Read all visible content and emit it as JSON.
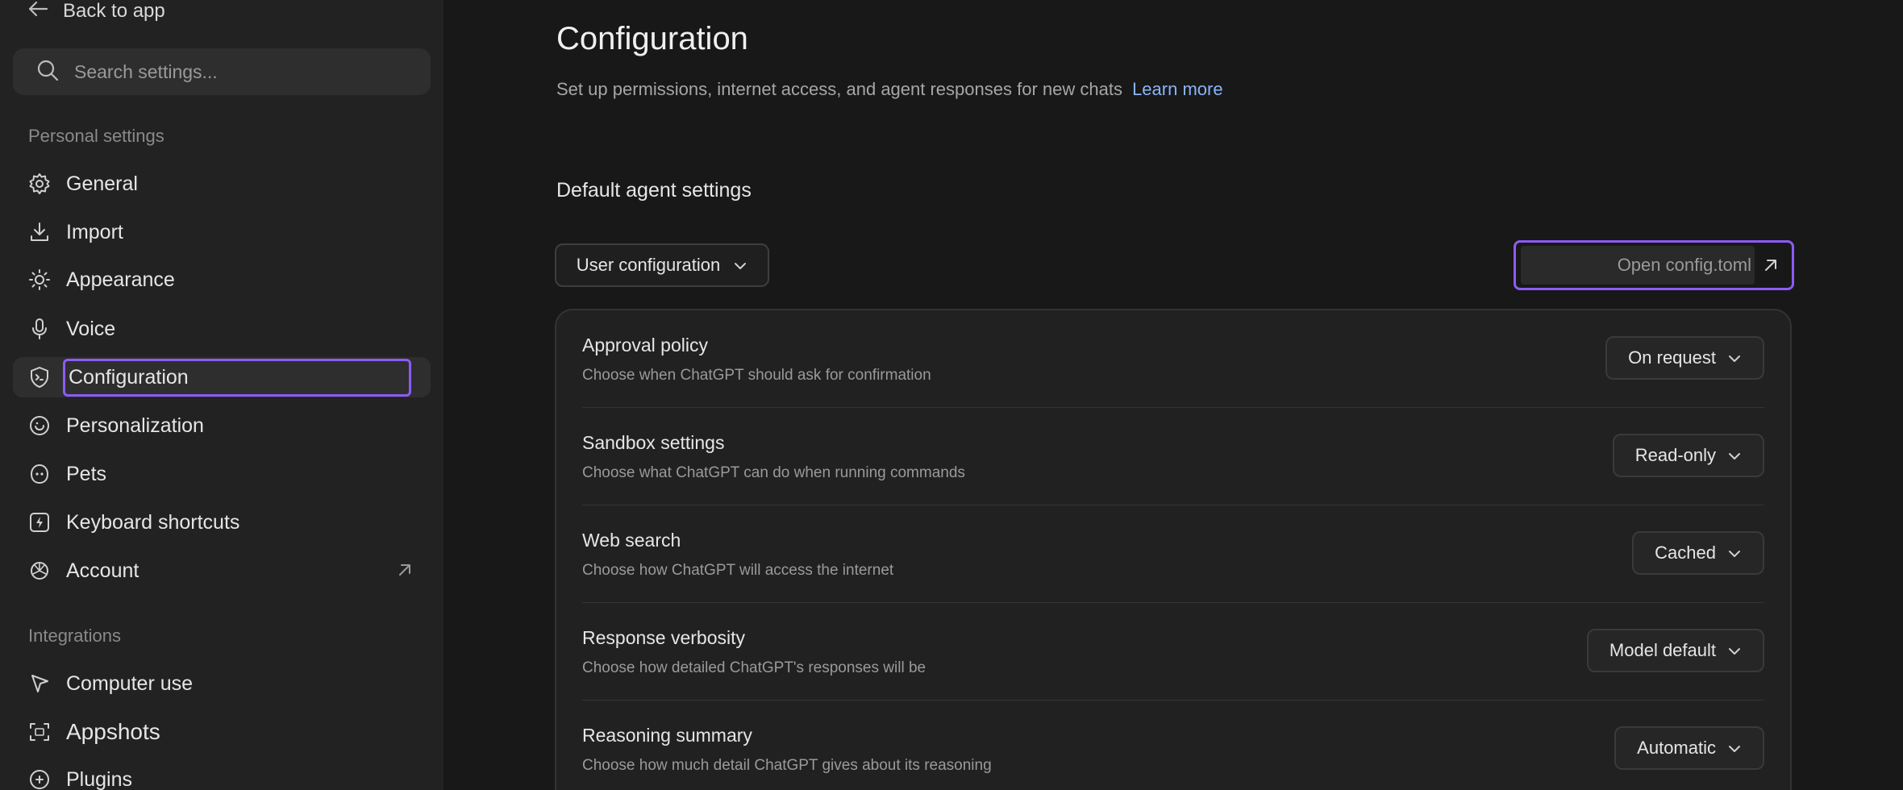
{
  "sidebar": {
    "back_label": "Back to app",
    "search_placeholder": "Search settings...",
    "personal_label": "Personal settings",
    "items": [
      {
        "label": "General"
      },
      {
        "label": "Import"
      },
      {
        "label": "Appearance"
      },
      {
        "label": "Voice"
      },
      {
        "label": "Configuration"
      },
      {
        "label": "Personalization"
      },
      {
        "label": "Pets"
      },
      {
        "label": "Keyboard shortcuts"
      },
      {
        "label": "Account"
      }
    ],
    "integrations_label": "Integrations",
    "integration_items": [
      {
        "label": "Computer use"
      },
      {
        "label": "Appshots"
      },
      {
        "label": "Plugins"
      }
    ]
  },
  "main": {
    "title": "Configuration",
    "subtitle": "Set up permissions, internet access, and agent responses for new chats",
    "learn_more": "Learn more",
    "section_title": "Default agent settings",
    "config_select": "User configuration",
    "open_config_label": "Open config.toml",
    "settings": [
      {
        "title": "Approval policy",
        "desc": "Choose when ChatGPT should ask for confirmation",
        "value": "On request"
      },
      {
        "title": "Sandbox settings",
        "desc": "Choose what ChatGPT can do when running commands",
        "value": "Read-only"
      },
      {
        "title": "Web search",
        "desc": "Choose how ChatGPT will access the internet",
        "value": "Cached"
      },
      {
        "title": "Response verbosity",
        "desc": "Choose how detailed ChatGPT's responses will be",
        "value": "Model default"
      },
      {
        "title": "Reasoning summary",
        "desc": "Choose how much detail ChatGPT gives about its reasoning",
        "value": "Automatic"
      }
    ]
  },
  "colors": {
    "accent": "#8b5cf6",
    "link": "#8ab4f8",
    "sidebar_bg": "#222222",
    "main_bg": "#181818"
  }
}
